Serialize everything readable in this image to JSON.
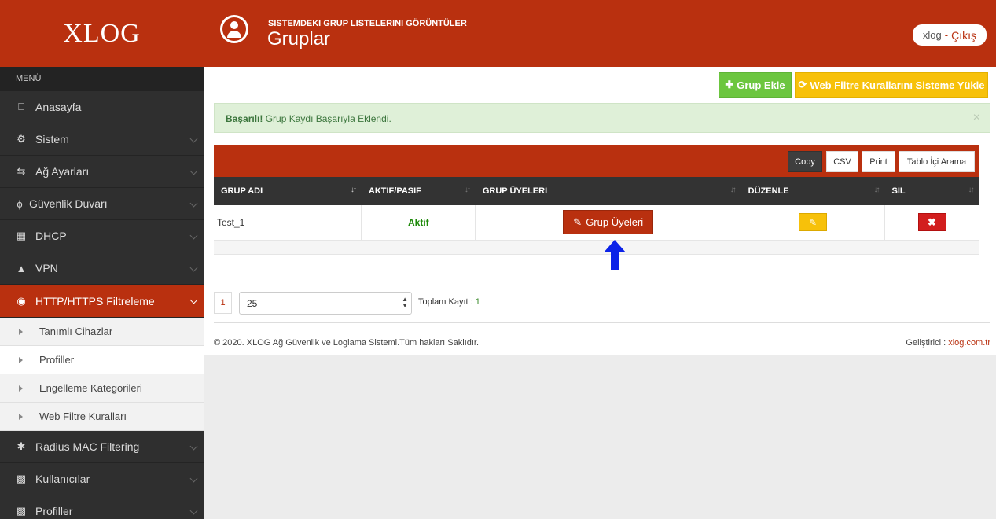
{
  "brand": {
    "logo_text": "XLOG"
  },
  "sidebar": {
    "menu_title": "MENÜ",
    "items": [
      {
        "label": "Anasayfa",
        "icon": "laptop-icon"
      },
      {
        "label": "Sistem",
        "icon": "cogs-icon"
      },
      {
        "label": "Ağ Ayarları",
        "icon": "random-icon"
      },
      {
        "label": "Güvenlik Duvarı",
        "icon": "bolt-icon"
      },
      {
        "label": "DHCP",
        "icon": "sitemap-icon"
      },
      {
        "label": "VPN",
        "icon": "road-icon"
      },
      {
        "label": "HTTP/HTTPS Filtreleme",
        "icon": "eye-slash-icon"
      },
      {
        "label": "Radius MAC Filtering",
        "icon": "asterisk-icon"
      },
      {
        "label": "Kullanıcılar",
        "icon": "th-large-icon"
      },
      {
        "label": "Profiller",
        "icon": "th-large-icon"
      }
    ],
    "sub_items": [
      {
        "label": "Tanımlı Cihazlar"
      },
      {
        "label": "Profiller"
      },
      {
        "label": "Engelleme Kategorileri"
      },
      {
        "label": "Web Filtre Kuralları"
      }
    ]
  },
  "header": {
    "subtitle": "SISTEMDEKI GRUP LISTELERINI GÖRÜNTÜLER",
    "title": "Gruplar",
    "user": "xlog",
    "separator": "-",
    "logout_label": "Çıkış"
  },
  "actions": {
    "add_group": "Grup Ekle",
    "load_rules": "Web Filtre Kurallarını Sisteme Yükle"
  },
  "alert": {
    "strong": "Başarılı!",
    "message": "Grup Kaydı Başarıyla Eklendi.",
    "close": "×"
  },
  "table_tools": {
    "copy": "Copy",
    "csv": "CSV",
    "print": "Print",
    "search": "Tablo İçi Arama"
  },
  "table": {
    "columns": [
      "GRUP ADI",
      "AKTIF/PASIF",
      "GRUP ÜYELERI",
      "DÜZENLE",
      "SIL"
    ],
    "rows": [
      {
        "name": "Test_1",
        "status": "Aktif",
        "members_button": "Grup Üyeleri"
      }
    ]
  },
  "pagination": {
    "current_page": "1",
    "page_size": "25",
    "total_label": "Toplam Kayıt :",
    "total_value": "1"
  },
  "footer": {
    "copyright": "© 2020. XLOG Ağ Güvenlik ve Loglama Sistemi.Tüm hakları Saklıdır.",
    "developer_label": "Geliştirici :",
    "developer_link": "xlog.com.tr"
  },
  "colors": {
    "brand": "#b9300f",
    "green": "#6cc63f",
    "yellow": "#f7c10a",
    "danger": "#d21e1e",
    "arrow": "#0b22e8"
  }
}
